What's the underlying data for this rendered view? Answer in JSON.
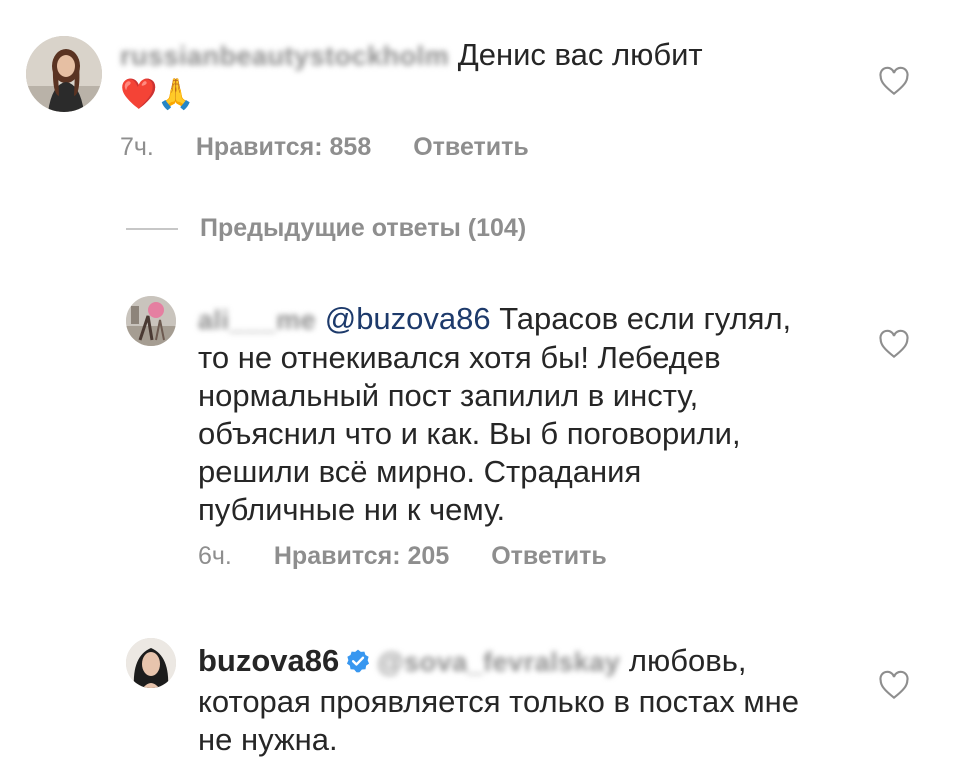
{
  "comments": [
    {
      "username_blurred": "russianbeautystockholm",
      "text": "Денис вас любит",
      "emoji": "❤️🙏",
      "time": "7ч.",
      "likes": "Нравится: 858",
      "reply": "Ответить"
    },
    {
      "username_blurred": "ali___me",
      "mention": "@buzova86",
      "text": " Тарасов если гулял, то не отнекивался хотя бы! Лебедев нормальный пост запилил в инсту, объяснил что и как. Вы б поговорили, решили всё мирно. Страдания публичные ни к чему.",
      "time": "6ч.",
      "likes": "Нравится: 205",
      "reply": "Ответить"
    },
    {
      "username": "buzova86",
      "mention_blurred": "@sova_fevralskay",
      "text": " любовь, которая проявляется только в постах мне не нужна."
    }
  ],
  "previous_replies": "Предыдущие ответы (104)",
  "colors": {
    "text": "#262626",
    "meta": "#8e8e8e",
    "mention": "#1d3a6b",
    "verified": "#3897f0",
    "heart_emoji": "#e0202f"
  },
  "icons": [
    "heart-outline-icon",
    "verified-badge-icon"
  ]
}
